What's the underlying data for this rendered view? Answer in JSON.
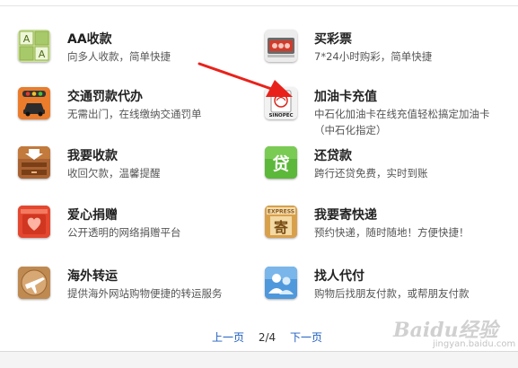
{
  "services": [
    {
      "title": "AA收款",
      "desc": "向多人收款，简单快捷",
      "icon": "aa-grid-icon"
    },
    {
      "title": "买彩票",
      "desc": "7*24小时购彩，简单快捷",
      "icon": "lottery-icon"
    },
    {
      "title": "交通罚款代办",
      "desc": "无需出门，在线缴纳交通罚单",
      "icon": "traffic-car-icon"
    },
    {
      "title": "加油卡充值",
      "desc": "中石化加油卡在线充值轻松搞定加油卡（中石化指定）",
      "icon": "sinopec-icon"
    },
    {
      "title": "我要收款",
      "desc": "收回欠款，温馨提醒",
      "icon": "collect-drawer-icon"
    },
    {
      "title": "还贷款",
      "desc": "跨行还贷免费，实时到账",
      "icon": "loan-icon"
    },
    {
      "title": "爱心捐赠",
      "desc": "公开透明的网络捐赠平台",
      "icon": "heart-donation-icon"
    },
    {
      "title": "我要寄快递",
      "desc": "预约快递，随时随地！方便快捷！",
      "icon": "express-icon"
    },
    {
      "title": "海外转运",
      "desc": "提供海外网站购物便捷的转运服务",
      "icon": "airplane-icon"
    },
    {
      "title": "找人代付",
      "desc": "购物后找朋友付款，或帮朋友付款",
      "icon": "friends-pay-icon"
    }
  ],
  "icon_text": {
    "aa_top": "A",
    "aa_bottom": "A",
    "loan": "贷",
    "express_label": "EXPRESS",
    "express_char": "寄",
    "sinopec": "SINOPEC"
  },
  "pager": {
    "prev": "上一页",
    "current": "2/4",
    "next": "下一页"
  },
  "watermark": {
    "brand": "Baidu经验",
    "url": "jingyan.baidu.com"
  }
}
